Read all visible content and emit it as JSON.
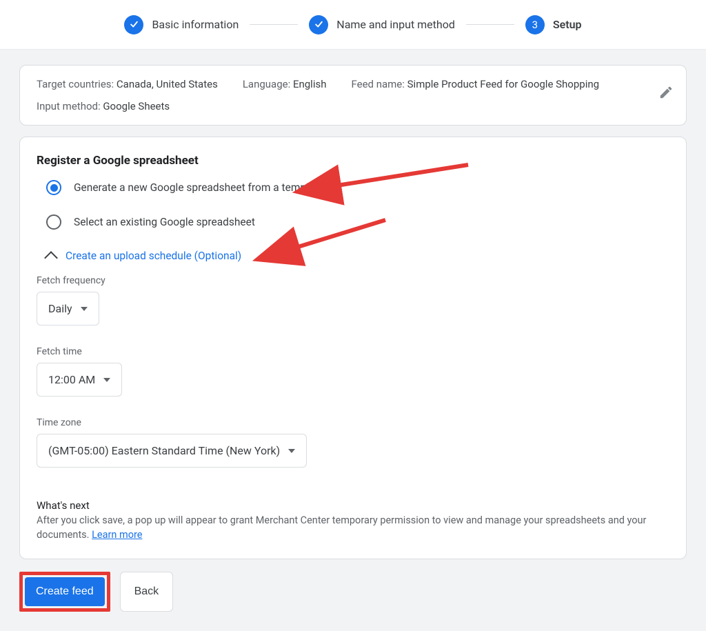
{
  "stepper": {
    "steps": [
      {
        "label": "Basic information",
        "state": "done"
      },
      {
        "label": "Name and input method",
        "state": "done"
      },
      {
        "label": "Setup",
        "state": "active",
        "number": "3"
      }
    ]
  },
  "summary": {
    "target_countries_label": "Target countries:",
    "target_countries_value": "Canada, United States",
    "language_label": "Language:",
    "language_value": "English",
    "feed_name_label": "Feed name:",
    "feed_name_value": "Simple Product Feed for Google Shopping",
    "input_method_label": "Input method:",
    "input_method_value": "Google Sheets"
  },
  "main": {
    "section_title": "Register a Google spreadsheet",
    "radio_generate": "Generate a new Google spreadsheet from a template",
    "radio_select_existing": "Select an existing Google spreadsheet",
    "upload_schedule_toggle": "Create an upload schedule (Optional)",
    "fetch_frequency_label": "Fetch frequency",
    "fetch_frequency_value": "Daily",
    "fetch_time_label": "Fetch time",
    "fetch_time_value": "12:00 AM",
    "time_zone_label": "Time zone",
    "time_zone_value": "(GMT-05:00) Eastern Standard Time (New York)",
    "whats_next_title": "What's next",
    "whats_next_body": "After you click save, a pop up will appear to grant Merchant Center temporary permission to view and manage your spreadsheets and your documents. ",
    "learn_more": "Learn more"
  },
  "footer": {
    "create_feed": "Create feed",
    "back": "Back"
  }
}
